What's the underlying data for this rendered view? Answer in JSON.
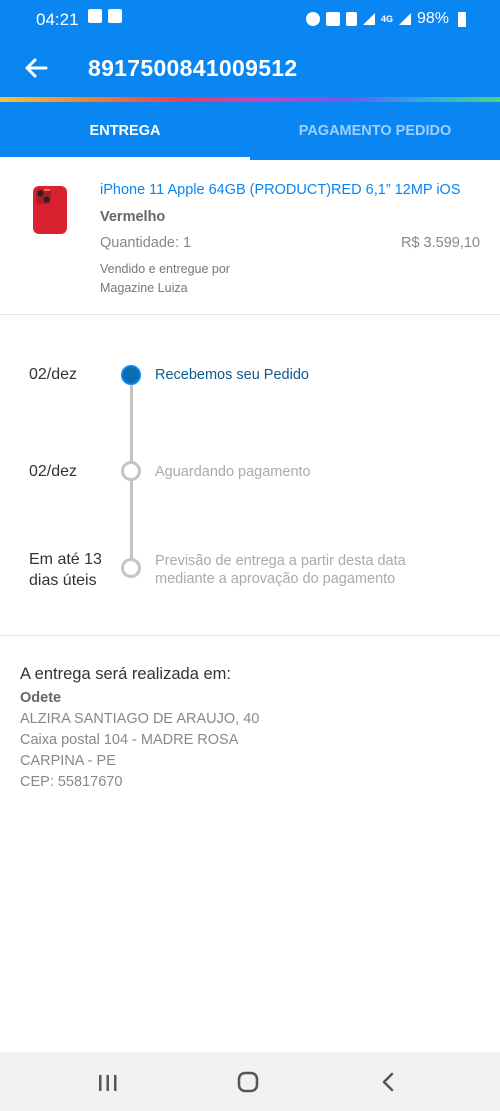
{
  "status_bar": {
    "time": "04:21",
    "network": "4G",
    "battery": "98%"
  },
  "header": {
    "order_number": "8917500841009512"
  },
  "tabs": [
    {
      "label": "ENTREGA",
      "active": true
    },
    {
      "label": "PAGAMENTO PEDIDO",
      "active": false
    }
  ],
  "product": {
    "name": "iPhone 11 Apple 64GB (PRODUCT)RED 6,1” 12MP iOS",
    "color": "Vermelho",
    "quantity": "Quantidade: 1",
    "price": "R$ 3.599,10",
    "sold_by_line1": "Vendido e entregue por",
    "sold_by_line2": "Magazine Luiza"
  },
  "timeline": [
    {
      "date": "02/dez",
      "label": "Recebemos seu Pedido",
      "status": "done"
    },
    {
      "date": "02/dez",
      "label": "Aguardando pagamento",
      "status": "pending"
    },
    {
      "date_line1": "Em até 13",
      "date_line2": "dias úteis",
      "label_line1": "Previsão de entrega a partir desta data",
      "label_line2": "mediante a aprovação do pagamento",
      "status": "pending"
    }
  ],
  "address": {
    "heading": "A entrega será realizada em:",
    "name": "Odete",
    "street": "ALZIRA SANTIAGO DE ARAUJO, 40",
    "complement": "Caixa postal 104 - MADRE ROSA",
    "city": "CARPINA - PE",
    "cep": "CEP: 55817670"
  },
  "colors": {
    "primary": "#0a86f2",
    "timeline_active": "#0b6db0",
    "product_red": "#d8222f"
  },
  "icons": {
    "back": "arrow-left-icon",
    "recents": "recent-apps-icon",
    "home": "home-icon",
    "nav_back": "chevron-left-icon"
  }
}
